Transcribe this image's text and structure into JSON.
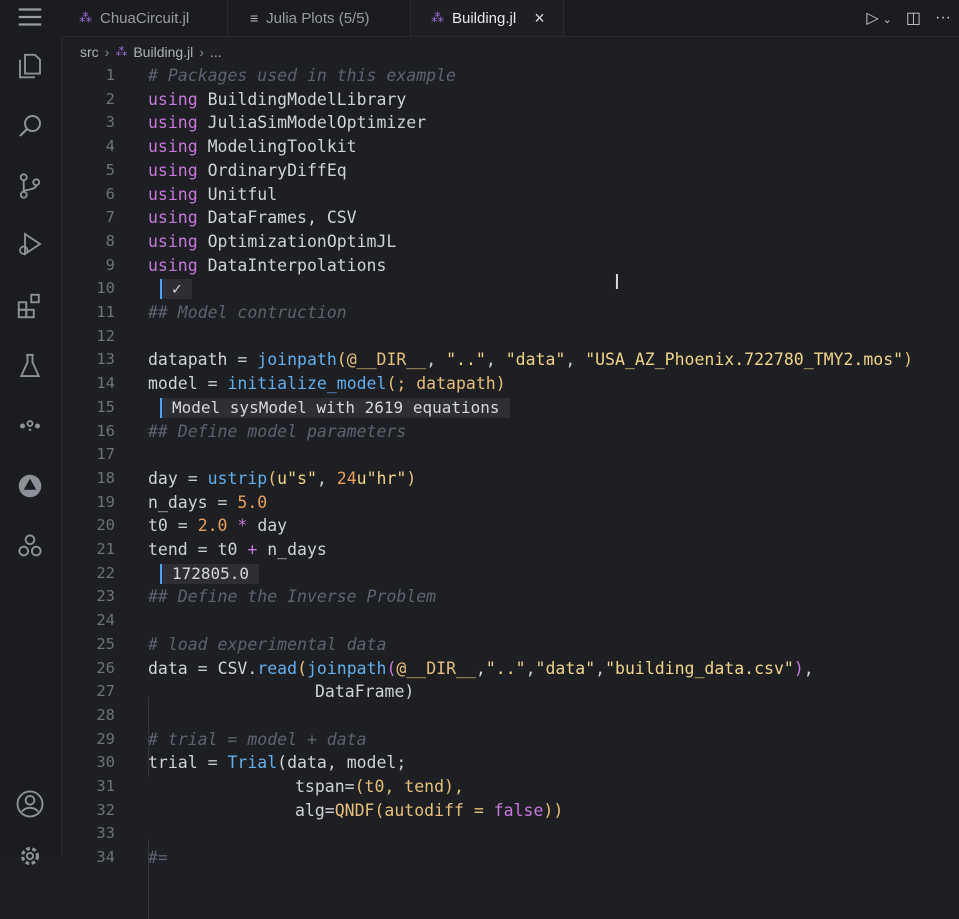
{
  "tabs": [
    {
      "label": "ChuaCircuit.jl",
      "icon": "julia-dots-icon"
    },
    {
      "label": "Julia Plots (5/5)",
      "icon": "list-icon"
    },
    {
      "label": "Building.jl",
      "icon": "julia-dots-icon",
      "active": true
    }
  ],
  "breadcrumb": {
    "folder": "src",
    "file": "Building.jl",
    "more": "..."
  },
  "activity_icons": [
    "explorer-icon",
    "search-icon",
    "source-control-icon",
    "run-debug-icon",
    "extensions-icon",
    "testing-icon",
    "julia-icon",
    "remote-icon",
    "julia-dependencies-icon",
    "account-icon",
    "settings-icon"
  ],
  "inline_results": {
    "line10": "✓",
    "line15": "Model sysModel with 2619 equations",
    "line22": "172805.0"
  },
  "lines": [
    {
      "n": "1"
    },
    {
      "n": "2"
    },
    {
      "n": "3"
    },
    {
      "n": "4"
    },
    {
      "n": "5"
    },
    {
      "n": "6"
    },
    {
      "n": "7"
    },
    {
      "n": "8"
    },
    {
      "n": "9"
    },
    {
      "n": "10"
    },
    {
      "n": "11"
    },
    {
      "n": "12"
    },
    {
      "n": "13"
    },
    {
      "n": "14"
    },
    {
      "n": "15"
    },
    {
      "n": "16"
    },
    {
      "n": "17"
    },
    {
      "n": "18"
    },
    {
      "n": "19"
    },
    {
      "n": "20"
    },
    {
      "n": "21"
    },
    {
      "n": "22"
    },
    {
      "n": "23"
    },
    {
      "n": "24"
    },
    {
      "n": "25"
    },
    {
      "n": "26"
    },
    {
      "n": "27"
    },
    {
      "n": "28"
    },
    {
      "n": "29"
    },
    {
      "n": "30"
    },
    {
      "n": "31"
    },
    {
      "n": "32"
    },
    {
      "n": "33"
    },
    {
      "n": "34"
    }
  ],
  "code": {
    "l1": "# Packages used in this example",
    "using": "using",
    "pkgs": [
      "BuildingModelLibrary",
      "JuliaSimModelOptimizer",
      "ModelingToolkit",
      "OrdinaryDiffEq",
      "Unitful",
      "DataFrames, CSV",
      "OptimizationOptimJL",
      "DataInterpolations"
    ],
    "l11": "## Model contruction",
    "l13_var": "datapath",
    "l13_eq": " = ",
    "l13_fn": "joinpath",
    "l13_open": "(",
    "l13_mac": "@__DIR__",
    "l13_s1": "\"..\"",
    "l13_s2": "\"data\"",
    "l13_s3": "\"USA_AZ_Phoenix.722780_TMY2.mos\"",
    "l13_close": ")",
    "comma": ", ",
    "l14_var": "model",
    "l14_fn": "initialize_model",
    "l14_args": "(; datapath)",
    "l16": "## Define model parameters",
    "l18_var": "day",
    "l18_fn": "ustrip",
    "l18_s1": "u\"s\"",
    "l18_n": "24",
    "l18_s2": "u\"hr\"",
    "l19_var": "n_days",
    "l19_n": "5.0",
    "l20_var": "t0",
    "l20_n": "2.0",
    "l20_star": " * ",
    "l20_rest": "day",
    "l21_var": "tend",
    "l21_rest1": "t0",
    "l21_plus": " + ",
    "l21_rest2": "n_days",
    "l23": "## Define the Inverse Problem",
    "l25": "# load experimental data",
    "l26_var": "data",
    "l26_mod": "CSV.",
    "l26_fn": "read",
    "l26_fn2": "joinpath",
    "l26_mac": "@__DIR__",
    "l26_s1": "\"..\"",
    "l26_s2": "\"data\"",
    "l26_s3": "\"building_data.csv\"",
    "l27": "DataFrame)",
    "l29": "# trial = model + data",
    "l30_var": "trial",
    "l30_fn": "Trial",
    "l30_args": "(data, model;",
    "l31_a": "tspan=",
    "l31_b": "(t0, tend),",
    "l32_a": "alg=",
    "l32_fn": "QNDF",
    "l32_b": "(autodiff = ",
    "l32_kw": "false",
    "l32_c": "))",
    "l34": "#="
  }
}
